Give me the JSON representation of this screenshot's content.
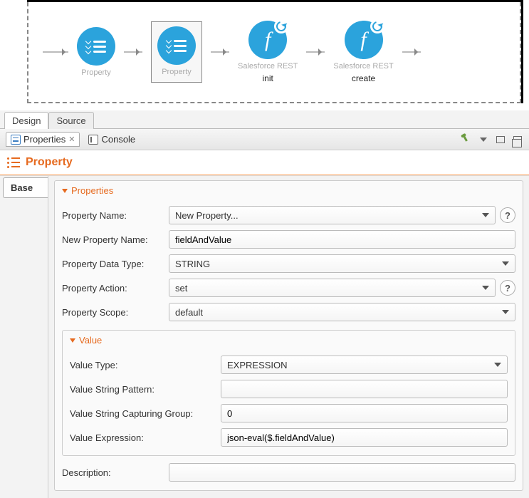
{
  "canvas": {
    "nodes": [
      {
        "top": "",
        "bottom": "Property",
        "kind": "checklist"
      },
      {
        "top": "",
        "bottom": "Property",
        "kind": "checklist",
        "selected": true
      },
      {
        "top": "Salesforce REST",
        "bottom": "init",
        "kind": "connector"
      },
      {
        "top": "Salesforce REST",
        "bottom": "create",
        "kind": "connector"
      }
    ]
  },
  "editorTabs": {
    "design": "Design",
    "source": "Source"
  },
  "views": {
    "properties": "Properties",
    "console": "Console"
  },
  "header": "Property",
  "sideTab": "Base",
  "section": {
    "title": "Properties",
    "rows": {
      "propertyNameLabel": "Property Name:",
      "propertyNameValue": "New Property...",
      "newPropertyNameLabel": "New Property Name:",
      "newPropertyNameValue": "fieldAndValue",
      "dataTypeLabel": "Property Data Type:",
      "dataTypeValue": "STRING",
      "actionLabel": "Property Action:",
      "actionValue": "set",
      "scopeLabel": "Property Scope:",
      "scopeValue": "default"
    },
    "value": {
      "title": "Value",
      "typeLabel": "Value Type:",
      "typeValue": "EXPRESSION",
      "patternLabel": "Value String Pattern:",
      "patternValue": "",
      "groupLabel": "Value String Capturing Group:",
      "groupValue": "0",
      "exprLabel": "Value Expression:",
      "exprValue": "json-eval($.fieldAndValue)"
    },
    "descLabel": "Description:",
    "descValue": ""
  }
}
